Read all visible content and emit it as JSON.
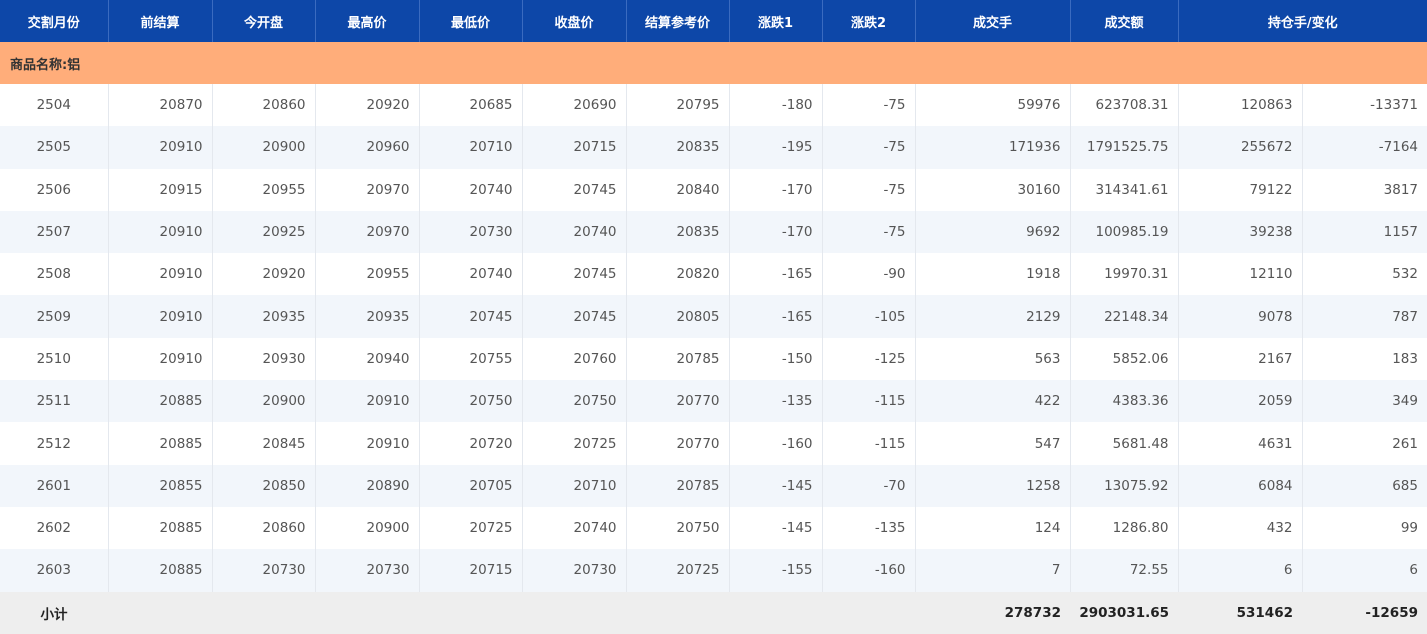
{
  "colors": {
    "header_bg": "#0d47a8",
    "group_bg": "#ffad7a",
    "row_alt_bg": "#f2f6fb",
    "footer_bg": "#eeeeee"
  },
  "headers": [
    "交割月份",
    "前结算",
    "今开盘",
    "最高价",
    "最低价",
    "收盘价",
    "结算参考价",
    "涨跌1",
    "涨跌2",
    "成交手",
    "成交额",
    "持仓手/变化"
  ],
  "group": {
    "label": "商品名称:铝"
  },
  "rows": [
    [
      "2504",
      "20870",
      "20860",
      "20920",
      "20685",
      "20690",
      "20795",
      "-180",
      "-75",
      "59976",
      "623708.31",
      "120863",
      "-13371"
    ],
    [
      "2505",
      "20910",
      "20900",
      "20960",
      "20710",
      "20715",
      "20835",
      "-195",
      "-75",
      "171936",
      "1791525.75",
      "255672",
      "-7164"
    ],
    [
      "2506",
      "20915",
      "20955",
      "20970",
      "20740",
      "20745",
      "20840",
      "-170",
      "-75",
      "30160",
      "314341.61",
      "79122",
      "3817"
    ],
    [
      "2507",
      "20910",
      "20925",
      "20970",
      "20730",
      "20740",
      "20835",
      "-170",
      "-75",
      "9692",
      "100985.19",
      "39238",
      "1157"
    ],
    [
      "2508",
      "20910",
      "20920",
      "20955",
      "20740",
      "20745",
      "20820",
      "-165",
      "-90",
      "1918",
      "19970.31",
      "12110",
      "532"
    ],
    [
      "2509",
      "20910",
      "20935",
      "20935",
      "20745",
      "20745",
      "20805",
      "-165",
      "-105",
      "2129",
      "22148.34",
      "9078",
      "787"
    ],
    [
      "2510",
      "20910",
      "20930",
      "20940",
      "20755",
      "20760",
      "20785",
      "-150",
      "-125",
      "563",
      "5852.06",
      "2167",
      "183"
    ],
    [
      "2511",
      "20885",
      "20900",
      "20910",
      "20750",
      "20750",
      "20770",
      "-135",
      "-115",
      "422",
      "4383.36",
      "2059",
      "349"
    ],
    [
      "2512",
      "20885",
      "20845",
      "20910",
      "20720",
      "20725",
      "20770",
      "-160",
      "-115",
      "547",
      "5681.48",
      "4631",
      "261"
    ],
    [
      "2601",
      "20855",
      "20850",
      "20890",
      "20705",
      "20710",
      "20785",
      "-145",
      "-70",
      "1258",
      "13075.92",
      "6084",
      "685"
    ],
    [
      "2602",
      "20885",
      "20860",
      "20900",
      "20725",
      "20740",
      "20750",
      "-145",
      "-135",
      "124",
      "1286.80",
      "432",
      "99"
    ],
    [
      "2603",
      "20885",
      "20730",
      "20730",
      "20715",
      "20730",
      "20725",
      "-155",
      "-160",
      "7",
      "72.55",
      "6",
      "6"
    ]
  ],
  "subtotal": {
    "label": "小计",
    "volume": "278732",
    "turnover": "2903031.65",
    "open_interest": "531462",
    "oi_change": "-12659"
  }
}
